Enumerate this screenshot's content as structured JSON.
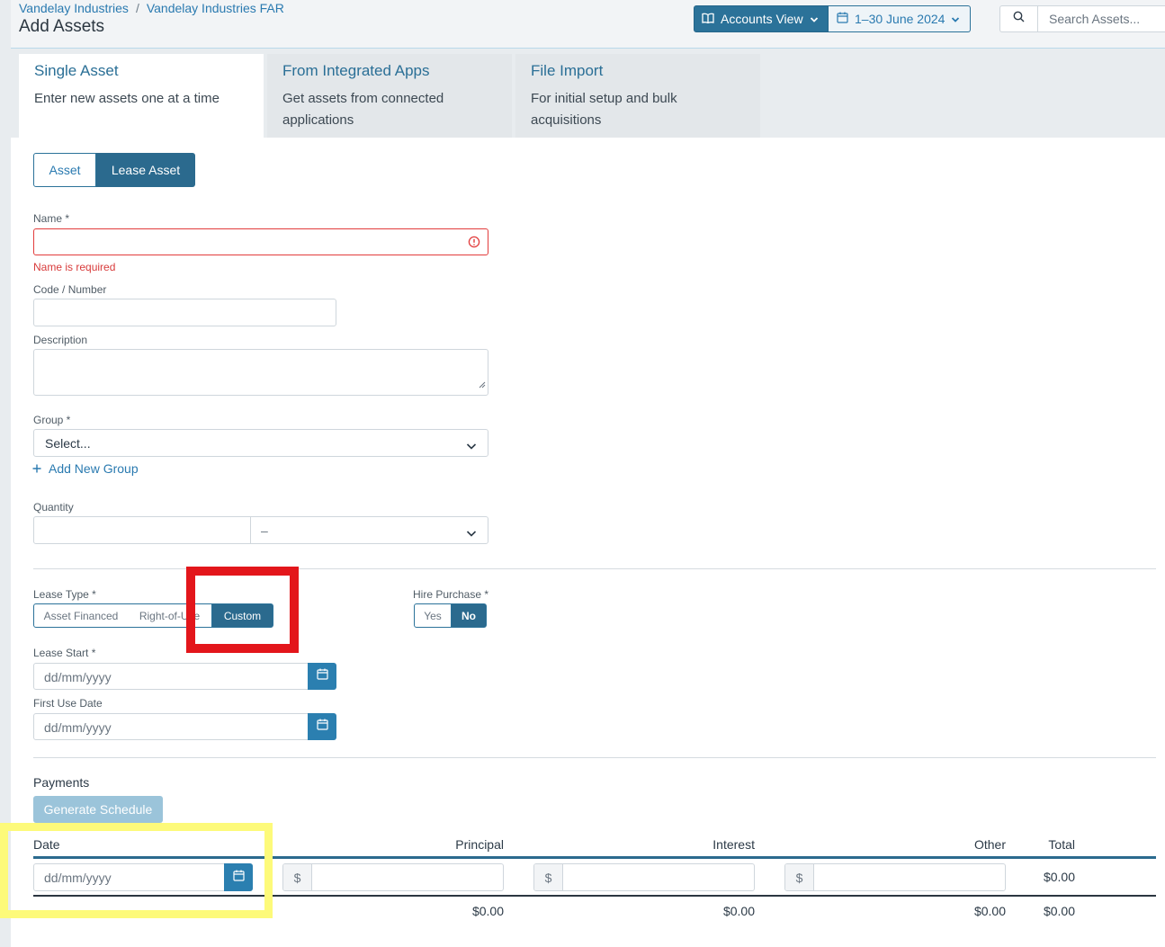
{
  "header": {
    "breadcrumb": [
      "Vandelay Industries",
      "Vandelay Industries FAR"
    ],
    "breadcrumb_separator": "/",
    "title": "Add Assets",
    "accounts_view_label": "Accounts View",
    "period_label": "1–30 June 2024",
    "search_placeholder": "Search Assets..."
  },
  "tabs": [
    {
      "title": "Single Asset",
      "desc_lines": [
        "Enter new assets one at a time"
      ]
    },
    {
      "title": "From Integrated Apps",
      "desc_lines": [
        "Get assets from connected",
        "applications"
      ]
    },
    {
      "title": "File Import",
      "desc_lines": [
        "For initial setup and bulk",
        "acquisitions"
      ]
    }
  ],
  "asset_type_toggle": {
    "asset": "Asset",
    "lease_asset": "Lease Asset",
    "selected": "Lease Asset"
  },
  "form": {
    "name_label": "Name *",
    "name_error": "Name is required",
    "code_label": "Code / Number",
    "description_label": "Description",
    "group_label": "Group *",
    "group_value": "Select...",
    "add_group_label": "Add New Group",
    "quantity_label": "Quantity",
    "quantity_unit_value": "–",
    "lease_type_label": "Lease Type *",
    "lease_type_options": [
      "Asset Financed",
      "Right-of-Use",
      "Custom"
    ],
    "lease_type_selected": "Custom",
    "hire_purchase_label": "Hire Purchase *",
    "hire_purchase_options": [
      "Yes",
      "No"
    ],
    "hire_purchase_selected": "No",
    "lease_start_label": "Lease Start *",
    "first_use_label": "First Use Date",
    "date_placeholder": "dd/mm/yyyy"
  },
  "payments": {
    "title": "Payments",
    "generate_label": "Generate Schedule",
    "columns": [
      "Date",
      "Principal",
      "Interest",
      "Other",
      "Total"
    ],
    "currency_symbol": "$",
    "row": {
      "date_placeholder": "dd/mm/yyyy",
      "total": "$0.00"
    },
    "totals": {
      "principal": "$0.00",
      "interest": "$0.00",
      "other": "$0.00",
      "total": "$0.00"
    }
  },
  "colors": {
    "accent": "#2b6a8e",
    "link": "#2a7ab0",
    "error": "#e23c3c",
    "annotation_red": "#e3161b",
    "annotation_yellow": "#fdfa7a"
  }
}
